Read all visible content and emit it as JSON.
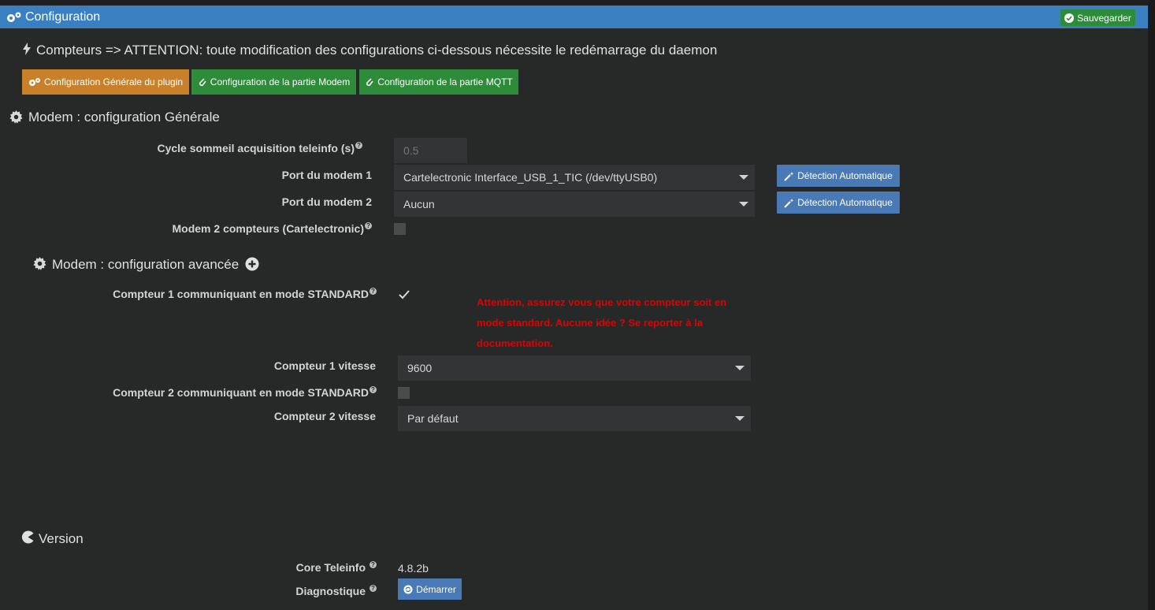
{
  "header": {
    "title": "Configuration",
    "save_label": "Sauvegarder"
  },
  "counters_notice": "Compteurs => ATTENTION: toute modification des configurations ci-dessous nécessite le redémarrage du daemon",
  "tabs": [
    {
      "label": "Configuration Générale du plugin",
      "color": "#c8812a"
    },
    {
      "label": "Configuration de la partie Modem",
      "color": "#2e8b3a"
    },
    {
      "label": "Configuration de la partie MQTT",
      "color": "#2e8b3a"
    }
  ],
  "modem_general": {
    "title": "Modem : configuration Générale",
    "cycle_label": "Cycle sommeil acquisition teleinfo (s)",
    "cycle_placeholder": "0.5",
    "port1_label": "Port du modem 1",
    "port1_value": "Cartelectronic Interface_USB_1_TIC (/dev/ttyUSB0)",
    "port2_label": "Port du modem 2",
    "port2_value": "Aucun",
    "detect_label": "Détection Automatique",
    "modem2_label": "Modem 2 compteurs (Cartelectronic)",
    "modem2_checked": false
  },
  "modem_advanced": {
    "title": "Modem : configuration avancée",
    "c1_std_label": "Compteur 1 communiquant en mode STANDARD",
    "c1_std_checked": true,
    "warning": "Attention, assurez vous que votre compteur soit en mode standard. Aucune idée ? Se reporter à la documentation.",
    "c1_speed_label": "Compteur 1 vitesse",
    "c1_speed_value": "9600",
    "c2_std_label": "Compteur 2 communiquant en mode STANDARD",
    "c2_std_checked": false,
    "c2_speed_label": "Compteur 2 vitesse",
    "c2_speed_value": "Par défaut"
  },
  "version": {
    "title": "Version",
    "core_label": "Core Teleinfo",
    "core_value": "4.8.2b",
    "diag_label": "Diagnostique",
    "start_label": "Démarrer"
  },
  "colors": {
    "header": "#3a7fbf",
    "save": "#2e8b3a",
    "blue_button": "#4a7ab5",
    "warning": "#e00000"
  }
}
